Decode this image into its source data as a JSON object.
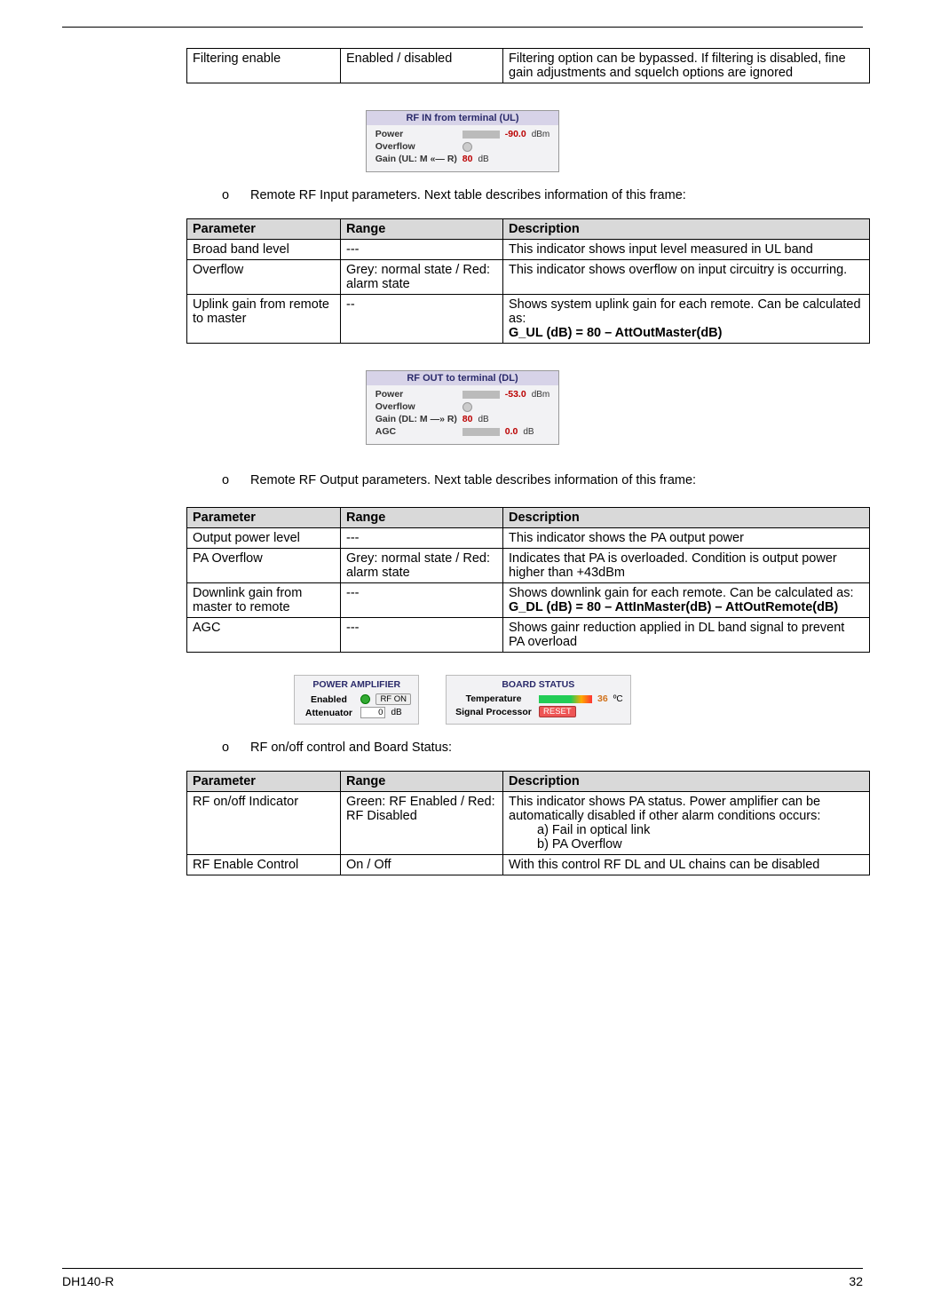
{
  "topTable": {
    "r1c1": "Filtering enable",
    "r1c2": "Enabled / disabled",
    "r1c3": "Filtering option can be bypassed. If filtering is disabled, fine gain adjustments and squelch options are ignored"
  },
  "fig1": {
    "title": "RF IN from terminal (UL)",
    "power_lbl": "Power",
    "power_val": "-90.0",
    "power_unit": "dBm",
    "ovf_lbl": "Overflow",
    "gain_lbl": "Gain (UL: M «— R)",
    "gain_val": "80",
    "gain_unit": "dB"
  },
  "bullet1": "Remote RF Input parameters. Next table describes information of this frame:",
  "table1": {
    "h1": "Parameter",
    "h2": "Range",
    "h3": "Description",
    "r1c1": "Broad band level",
    "r1c2": "---",
    "r1c3": "This indicator shows input level measured in UL band",
    "r2c1": "Overflow",
    "r2c2": "Grey: normal state / Red: alarm state",
    "r2c3": "This indicator shows overflow on input circuitry is occurring.",
    "r3c1": "Uplink gain from remote to master",
    "r3c2": "--",
    "r3c3a": "Shows system uplink gain for each remote. Can be calculated as:",
    "r3c3b": "G_UL (dB) = 80 – AttOutMaster(dB)"
  },
  "fig2": {
    "title": "RF OUT to terminal (DL)",
    "power_lbl": "Power",
    "power_val": "-53.0",
    "power_unit": "dBm",
    "ovf_lbl": "Overflow",
    "gain_lbl": "Gain (DL: M —» R)",
    "gain_val": "80",
    "gain_unit": "dB",
    "agc_lbl": "AGC",
    "agc_val": "0.0",
    "agc_unit": "dB"
  },
  "bullet2": "Remote RF Output parameters. Next table describes information of this frame:",
  "table2": {
    "h1": "Parameter",
    "h2": "Range",
    "h3": "Description",
    "r1c1": "Output power level",
    "r1c2": "---",
    "r1c3": "This indicator shows the PA output power",
    "r2c1": " PA Overflow",
    "r2c2": "Grey: normal state / Red: alarm state",
    "r2c3": "Indicates that PA is overloaded. Condition is output power higher than +43dBm",
    "r3c1": "Downlink gain from master to remote",
    "r3c2": "---",
    "r3c3a": "Shows downlink gain for each remote. Can be calculated as:",
    "r3c3b": "G_DL (dB) = 80 – AttInMaster(dB) – AttOutRemote(dB)",
    "r4c1": "AGC",
    "r4c2": "---",
    "r4c3": "Shows gainr reduction applied in DL band signal to prevent PA overload"
  },
  "fig3": {
    "pa_title": "POWER AMPLIFIER",
    "en_lbl": "Enabled",
    "rf_btn": "RF ON",
    "att_lbl": "Attenuator",
    "att_val": "0",
    "att_unit": "dB",
    "bs_title": "BOARD STATUS",
    "temp_lbl": "Temperature",
    "temp_val": "36",
    "temp_unit": "ºC",
    "sp_lbl": "Signal Processor",
    "reset_btn": "RESET"
  },
  "bullet3": "RF on/off control and Board Status:",
  "table3": {
    "h1": "Parameter",
    "h2": "Range",
    "h3": "Description",
    "r1c1": "RF on/off Indicator",
    "r1c2": "Green: RF Enabled / Red: RF Disabled",
    "r1c3a": "This indicator shows PA status. Power amplifier can be automatically disabled if other alarm conditions occurs:",
    "r1c3b": "a)    Fail in optical link",
    "r1c3c": "b)    PA Overflow",
    "r2c1": "RF Enable Control",
    "r2c2": "On / Off",
    "r2c3": "With this control RF DL and UL chains can be disabled"
  },
  "footer": {
    "left": "DH140-R",
    "right": "32"
  },
  "o": "o"
}
